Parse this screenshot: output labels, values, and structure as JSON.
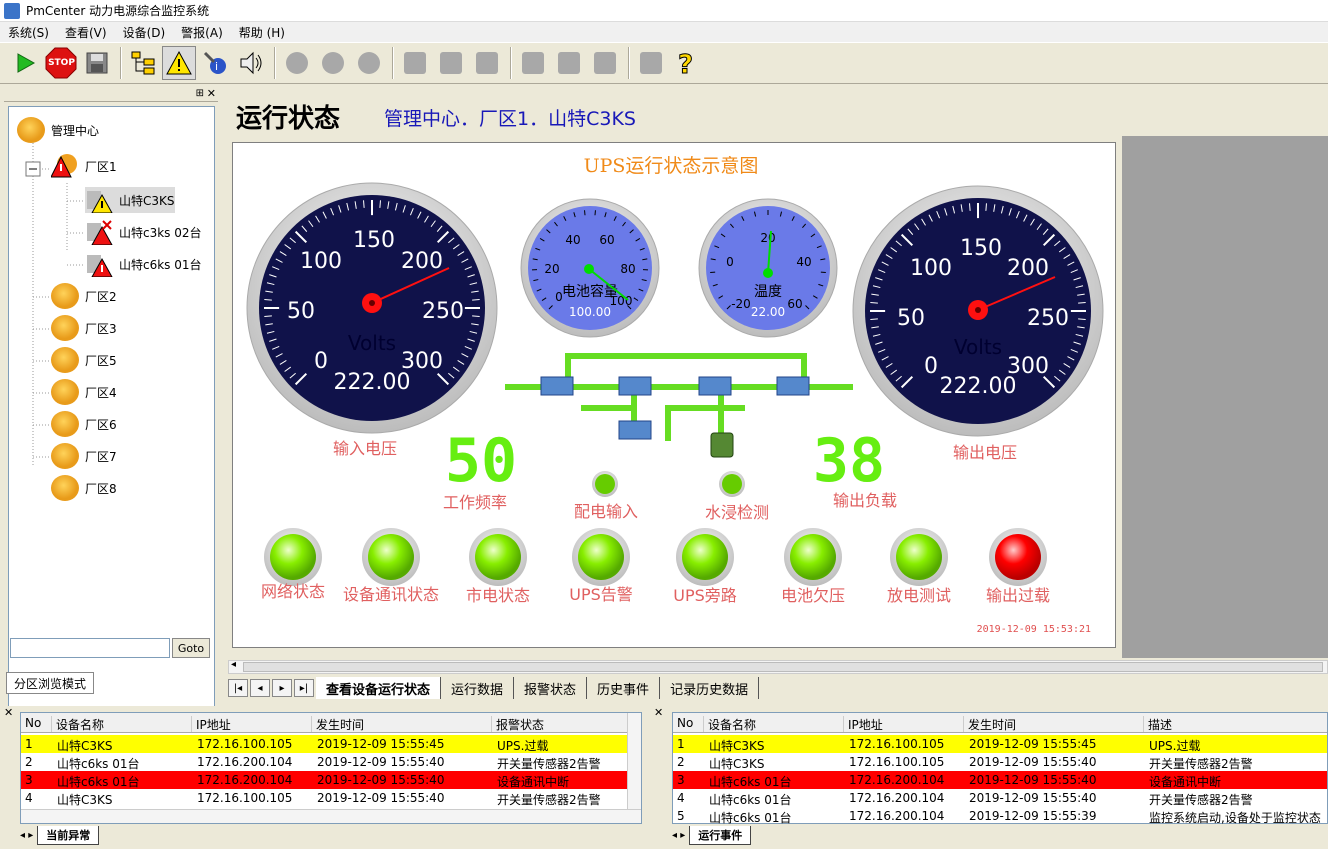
{
  "window": {
    "title": "PmCenter 动力电源综合监控系统"
  },
  "menu": [
    "系统(S)",
    "查看(V)",
    "设备(D)",
    "警报(A)",
    "帮助 (H)"
  ],
  "toolbar": {
    "stop_label": "STOP"
  },
  "tree": {
    "root": "管理中心",
    "zone1": "厂区1",
    "devices": [
      "山特C3KS",
      "山特c3ks 02台",
      "山特c6ks 01台"
    ],
    "zones": [
      "厂区2",
      "厂区3",
      "厂区5",
      "厂区4",
      "厂区6",
      "厂区7",
      "厂区8"
    ]
  },
  "goto": {
    "button": "Goto",
    "value": ""
  },
  "mode_tab": "分区浏览模式",
  "main": {
    "title": "运行状态",
    "path": "管理中心．厂区1．山特C3KS"
  },
  "diagram": {
    "title": "UPS运行状态示意图",
    "input_gauge": {
      "label": "输入电压",
      "unit": "Volts",
      "value": "222.00",
      "ticks": [
        "0",
        "50",
        "100",
        "150",
        "200",
        "250",
        "300"
      ]
    },
    "output_gauge": {
      "label": "输出电压",
      "unit": "Volts",
      "value": "222.00",
      "ticks": [
        "0",
        "50",
        "100",
        "150",
        "200",
        "250",
        "300"
      ]
    },
    "battery_gauge": {
      "label": "电池容量",
      "value": "100.00",
      "ticks": [
        "0",
        "20",
        "40",
        "60",
        "80",
        "100"
      ]
    },
    "temp_gauge": {
      "label": "温度",
      "value": "22.00",
      "ticks": [
        "-20",
        "0",
        "20",
        "40",
        "60"
      ]
    },
    "frequency": {
      "label": "工作频率",
      "value": "50"
    },
    "load": {
      "label": "输出负载",
      "value": "38"
    },
    "small_leds": [
      {
        "label": "配电输入",
        "color": "#66cc00"
      },
      {
        "label": "水浸检测",
        "color": "#66cc00"
      }
    ],
    "leds": [
      {
        "label": "网络状态",
        "color": "#77ee00"
      },
      {
        "label": "设备通讯状态",
        "color": "#77ee00"
      },
      {
        "label": "市电状态",
        "color": "#77ee00"
      },
      {
        "label": "UPS告警",
        "color": "#77ee00"
      },
      {
        "label": "UPS旁路",
        "color": "#77ee00"
      },
      {
        "label": "电池欠压",
        "color": "#77ee00"
      },
      {
        "label": "放电测试",
        "color": "#77ee00"
      },
      {
        "label": "输出过载",
        "color": "#ff0000"
      }
    ],
    "timestamp": "2019-12-09 15:53:21"
  },
  "tabs": [
    "查看设备运行状态",
    "运行数据",
    "报警状态",
    "历史事件",
    "记录历史数据"
  ],
  "alarm_list": {
    "headers": [
      "No",
      "设备名称",
      "IP地址",
      "发生时间",
      "报警状态"
    ],
    "rows": [
      [
        "1",
        "山特C3KS",
        "172.16.100.105",
        "2019-12-09 15:55:45",
        "UPS.过载"
      ],
      [
        "2",
        "山特c6ks 01台",
        "172.16.200.104",
        "2019-12-09 15:55:40",
        "开关量传感器2告警"
      ],
      [
        "3",
        "山特c6ks 01台",
        "172.16.200.104",
        "2019-12-09 15:55:40",
        "设备通讯中断"
      ],
      [
        "4",
        "山特C3KS",
        "172.16.100.105",
        "2019-12-09 15:55:40",
        "开关量传感器2告警"
      ]
    ],
    "tab": "当前异常"
  },
  "event_list": {
    "headers": [
      "No",
      "设备名称",
      "IP地址",
      "发生时间",
      "描述"
    ],
    "rows": [
      [
        "1",
        "山特C3KS",
        "172.16.100.105",
        "2019-12-09 15:55:45",
        "UPS.过载"
      ],
      [
        "2",
        "山特C3KS",
        "172.16.100.105",
        "2019-12-09 15:55:40",
        "开关量传感器2告警"
      ],
      [
        "3",
        "山特c6ks 01台",
        "172.16.200.104",
        "2019-12-09 15:55:40",
        "设备通讯中断"
      ],
      [
        "4",
        "山特c6ks 01台",
        "172.16.200.104",
        "2019-12-09 15:55:40",
        "开关量传感器2告警"
      ],
      [
        "5",
        "山特c6ks 01台",
        "172.16.200.104",
        "2019-12-09 15:55:39",
        "监控系统启动,设备处于监控状态"
      ]
    ],
    "tab": "运行事件"
  },
  "row_colors": {
    "yellow": "#ffff00",
    "red": "#ff0000"
  }
}
